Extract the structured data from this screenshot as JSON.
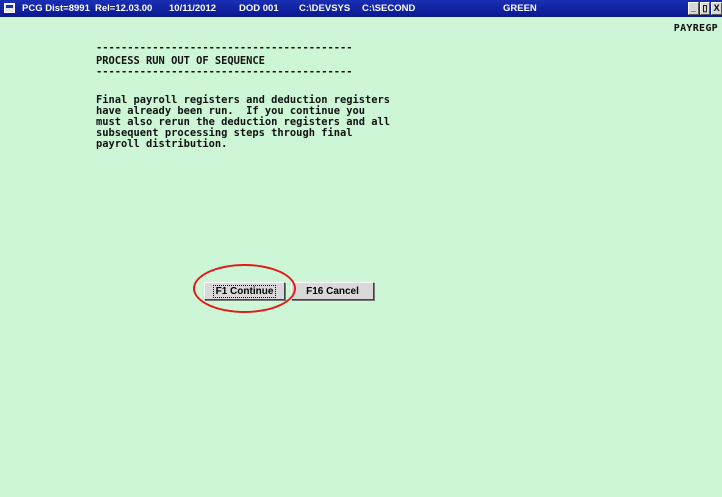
{
  "titlebar": {
    "dist": "PCG Dist=8991",
    "rel": "Rel=12.03.00",
    "date": "10/11/2012",
    "dod": "DOD 001",
    "path1": "C:\\DEVSYS",
    "path2": "C:\\SECOND",
    "theme": "GREEN"
  },
  "window_controls": {
    "minimize": "_",
    "restore": "▯",
    "close": "X"
  },
  "screen_id": "PAYREGP",
  "heading": {
    "rule_top": "-----------------------------------------",
    "title": "PROCESS RUN OUT OF SEQUENCE",
    "rule_bottom": "-----------------------------------------"
  },
  "message_lines": [
    "Final payroll registers and deduction registers",
    "have already been run.  If you continue you",
    "must also rerun the deduction registers and all",
    "subsequent processing steps through final",
    "payroll distribution."
  ],
  "buttons": {
    "continue": "F1 Continue",
    "cancel": "F16 Cancel"
  },
  "colors": {
    "background": "#cdf6d6",
    "titlebar": "#1a2fb4",
    "highlight": "#e21919"
  }
}
